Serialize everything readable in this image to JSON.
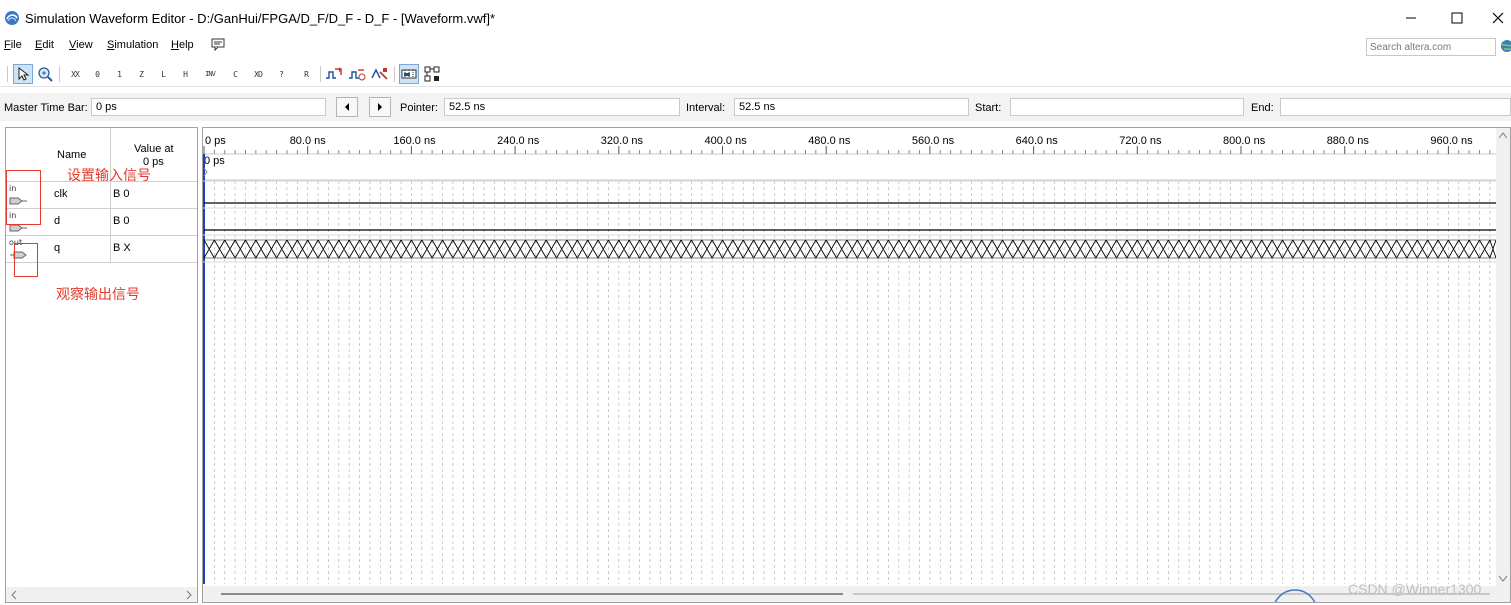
{
  "window": {
    "title": "Simulation Waveform Editor - D:/GanHui/FPGA/D_F/D_F - D_F - [Waveform.vwf]*"
  },
  "menu": [
    {
      "label": "File",
      "underline": "F",
      "rest": "ile"
    },
    {
      "label": "Edit",
      "underline": "E",
      "rest": "dit"
    },
    {
      "label": "View",
      "underline": "V",
      "rest": "iew"
    },
    {
      "label": "Simulation",
      "underline": "S",
      "rest": "imulation"
    },
    {
      "label": "Help",
      "underline": "H",
      "rest": "elp"
    }
  ],
  "search": {
    "placeholder": "Search altera.com"
  },
  "toolbar": {
    "buttons": [
      {
        "name": "selection-tool-icon",
        "active": true
      },
      {
        "name": "zoom-tool-icon",
        "active": false
      },
      {
        "name": "force-unknown-icon",
        "text": "XX"
      },
      {
        "name": "force-low-icon",
        "text": "0"
      },
      {
        "name": "force-high-icon",
        "text": "1"
      },
      {
        "name": "force-high-impedance-icon",
        "text": "Z"
      },
      {
        "name": "force-weak-low-icon",
        "text": "L"
      },
      {
        "name": "force-weak-high-icon",
        "text": "H"
      },
      {
        "name": "invert-icon",
        "text": "INV"
      },
      {
        "name": "count-value-icon",
        "text": "C"
      },
      {
        "name": "overwrite-clock-icon",
        "text": "XO"
      },
      {
        "name": "random-values-icon",
        "text": "?"
      },
      {
        "name": "arbitrary-value-icon",
        "text": "R"
      },
      {
        "name": "run-functional-simulation-icon"
      },
      {
        "name": "run-timing-simulation-icon"
      },
      {
        "name": "generate-netlist-icon"
      },
      {
        "name": "snap-to-grid-icon",
        "active": true
      },
      {
        "name": "grid-settings-icon"
      }
    ]
  },
  "timebar": {
    "master_label": "Master Time Bar:",
    "master_value": "0 ps",
    "pointer_label": "Pointer:",
    "pointer_value": "52.5 ns",
    "interval_label": "Interval:",
    "interval_value": "52.5 ns",
    "start_label": "Start:",
    "start_value": "",
    "end_label": "End:",
    "end_value": ""
  },
  "name_pane": {
    "header_name": "Name",
    "header_value_line1": "Value at",
    "header_value_line2": "0 ps",
    "signals": [
      {
        "type": "in",
        "name": "clk",
        "value": "B 0"
      },
      {
        "type": "in",
        "name": "d",
        "value": "B 0"
      },
      {
        "type": "out",
        "name": "q",
        "value": "B X"
      }
    ]
  },
  "annotations": {
    "input_note": "设置输入信号",
    "output_note": "观察输出信号",
    "color": "#e03b2e"
  },
  "wave": {
    "time_labels": [
      "0 ps",
      "80.0 ns",
      "160.0 ns",
      "240.0 ns",
      "320.0 ns",
      "400.0 ns",
      "480.0 ns",
      "560.0 ns",
      "640.0 ns",
      "720.0 ns",
      "800.0 ns",
      "880.0 ns",
      "960.0 ns"
    ],
    "master_marker_label": "0 ps",
    "signals": [
      {
        "name": "clk",
        "state": "low"
      },
      {
        "name": "d",
        "state": "low"
      },
      {
        "name": "q",
        "state": "unknown"
      }
    ]
  },
  "watermark": "CSDN @Winner1300"
}
